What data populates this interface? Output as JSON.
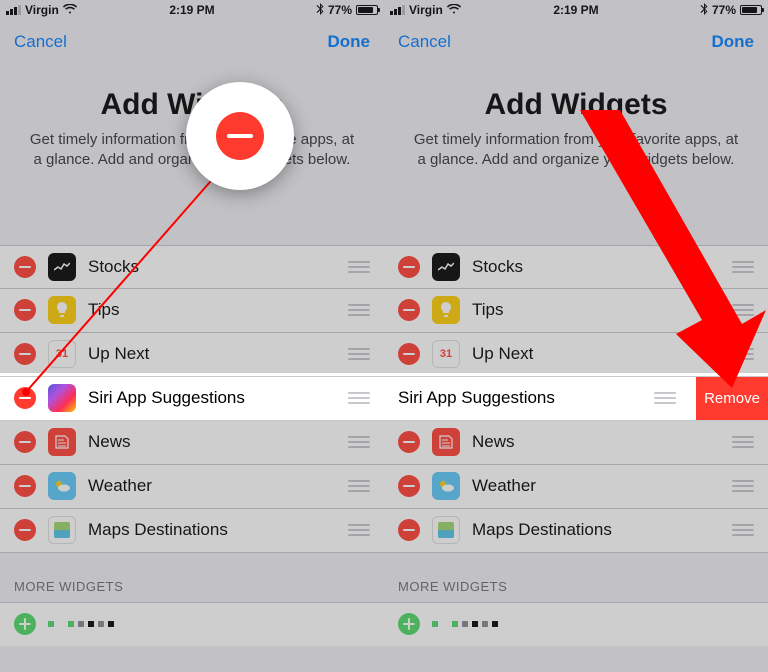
{
  "status": {
    "carrier": "Virgin",
    "time": "2:19 PM",
    "battery_pct": "77%"
  },
  "nav": {
    "cancel": "Cancel",
    "done": "Done"
  },
  "header": {
    "title": "Add Widgets",
    "subtitle": "Get timely information from your favorite apps, at a glance. Add and organize your widgets below."
  },
  "widgets": [
    {
      "label": "Stocks",
      "icon": "stocks"
    },
    {
      "label": "Tips",
      "icon": "tips"
    },
    {
      "label": "Up Next",
      "icon": "upnext",
      "badge": "31"
    },
    {
      "label": "Siri App Suggestions",
      "icon": "siri",
      "highlight": true
    },
    {
      "label": "News",
      "icon": "news"
    },
    {
      "label": "Weather",
      "icon": "weather"
    },
    {
      "label": "Maps Destinations",
      "icon": "maps"
    }
  ],
  "section_more": "MORE WIDGETS",
  "remove_label": "Remove"
}
